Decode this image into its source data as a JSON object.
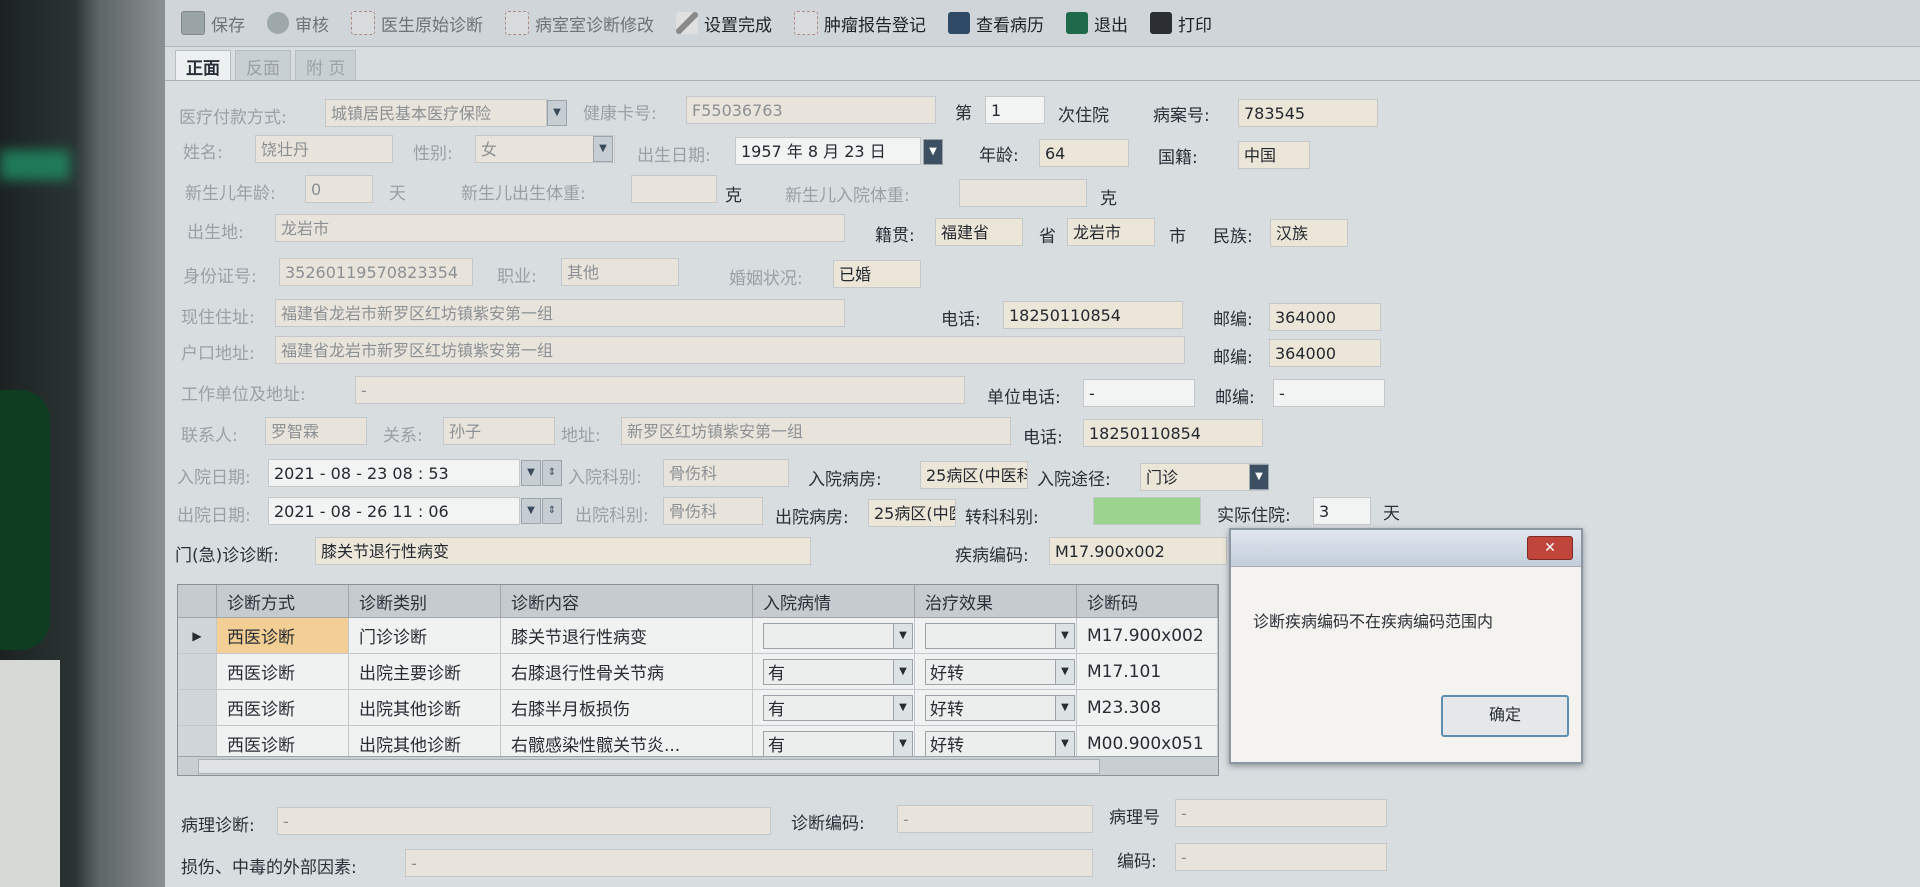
{
  "toolbar": {
    "save": "保存",
    "review": "审核",
    "doctor_diag": "医生原始诊断",
    "ward_diag_edit": "病室室诊断修改",
    "settings_done": "设置完成",
    "tumor_report": "肿瘤报告登记",
    "view_record": "查看病历",
    "exit": "退出",
    "print": "打印"
  },
  "tabs": [
    "正面",
    "反面",
    "附 页"
  ],
  "form": {
    "payment_label": "医疗付款方式:",
    "payment_value": "城镇居民基本医疗保险",
    "health_card_label": "健康卡号:",
    "health_card_value": "F55036763",
    "admission_no_prefix": "第",
    "admission_no_value": "1",
    "admission_no_suffix": "次住院",
    "case_no_label": "病案号:",
    "case_no_value": "783545",
    "name_label": "姓名:",
    "name_value": "饶壮丹",
    "sex_label": "性别:",
    "sex_value": "女",
    "birth_label": "出生日期:",
    "birth_value": "1957 年 8 月 23 日",
    "age_label": "年龄:",
    "age_value": "64",
    "nation_label": "国籍:",
    "nation_value": "中国",
    "newborn_age_label": "新生儿年龄:",
    "newborn_age_value": "0",
    "newborn_age_unit": "天",
    "newborn_weight_label": "新生儿出生体重:",
    "newborn_weight_unit": "克",
    "newborn_in_weight_label": "新生儿入院体重:",
    "newborn_in_weight_unit": "克",
    "birthplace_label": "出生地:",
    "birthplace_value": "龙岩市",
    "native_label": "籍贯:",
    "native_province": "福建省",
    "native_province_unit": "省",
    "native_city": "龙岩市",
    "native_city_unit": "市",
    "ethnic_label": "民族:",
    "ethnic_value": "汉族",
    "id_label": "身份证号:",
    "id_value": "35260119570823354",
    "job_label": "职业:",
    "job_value": "其他",
    "marriage_label": "婚姻状况:",
    "marriage_value": "已婚",
    "address_label": "现住住址:",
    "address_value": "福建省龙岩市新罗区红坊镇紫安第一组",
    "phone_label": "电话:",
    "phone_value": "18250110854",
    "zip_label": "邮编:",
    "zip_value": "364000",
    "hukou_label": "户口地址:",
    "hukou_value": "福建省龙岩市新罗区红坊镇紫安第一组",
    "hukou_zip_label": "邮编:",
    "hukou_zip_value": "364000",
    "work_label": "工作单位及地址:",
    "work_value": "-",
    "work_phone_label": "单位电话:",
    "work_phone_value": "-",
    "work_zip_label": "邮编:",
    "work_zip_value": "-",
    "contact_label": "联系人:",
    "contact_value": "罗智霖",
    "relation_label": "关系:",
    "relation_value": "孙子",
    "contact_addr_label": "地址:",
    "contact_addr_value": "新罗区红坊镇紫安第一组",
    "contact_phone_label": "电话:",
    "contact_phone_value": "18250110854",
    "in_date_label": "入院日期:",
    "in_date_value": "2021 - 08 - 23   08 : 53",
    "in_dept_label": "入院科别:",
    "in_dept_value": "骨伤科",
    "in_ward_label": "入院病房:",
    "in_ward_value": "25病区(中医科",
    "in_route_label": "入院途径:",
    "in_route_value": "门诊",
    "out_date_label": "出院日期:",
    "out_date_value": "2021 - 08 - 26   11 : 06",
    "out_dept_label": "出院科别:",
    "out_dept_value": "骨伤科",
    "out_ward_label": "出院病房:",
    "out_ward_value": "25病区(中医",
    "transfer_label": "转科科别:",
    "stay_label": "实际住院:",
    "stay_value": "3",
    "stay_unit": "天",
    "op_diag_label": "门(急)诊诊断:",
    "op_diag_value": "膝关节退行性病变",
    "disease_code_label": "疾病编码:",
    "disease_code_value": "M17.900x002"
  },
  "grid": {
    "headers": [
      "诊断方式",
      "诊断类别",
      "诊断内容",
      "入院病情",
      "治疗效果",
      "诊断码"
    ],
    "rows": [
      {
        "method": "西医诊断",
        "category": "门诊诊断",
        "content": "膝关节退行性病变",
        "condition": "",
        "effect": "",
        "code": "M17.900x002"
      },
      {
        "method": "西医诊断",
        "category": "出院主要诊断",
        "content": "右膝退行性骨关节病",
        "condition": "有",
        "effect": "好转",
        "code": "M17.101"
      },
      {
        "method": "西医诊断",
        "category": "出院其他诊断",
        "content": "右膝半月板损伤",
        "condition": "有",
        "effect": "好转",
        "code": "M23.308"
      },
      {
        "method": "西医诊断",
        "category": "出院其他诊断",
        "content": "右髋感染性髋关节炎...",
        "condition": "有",
        "effect": "好转",
        "code": "M00.900x051"
      }
    ]
  },
  "bottom": {
    "path_diag_label": "病理诊断:",
    "path_diag_value": "-",
    "diag_code_label": "诊断编码:",
    "diag_code_value": "-",
    "path_no_label": "病理号",
    "path_no_value": "-",
    "injury_label": "损伤、中毒的外部因素:",
    "injury_value": "-",
    "code_label": "编码:",
    "code_value": "-"
  },
  "dialog": {
    "message": "诊断疾病编码不在疾病编码范围内",
    "ok": "确定",
    "close": "✕"
  }
}
